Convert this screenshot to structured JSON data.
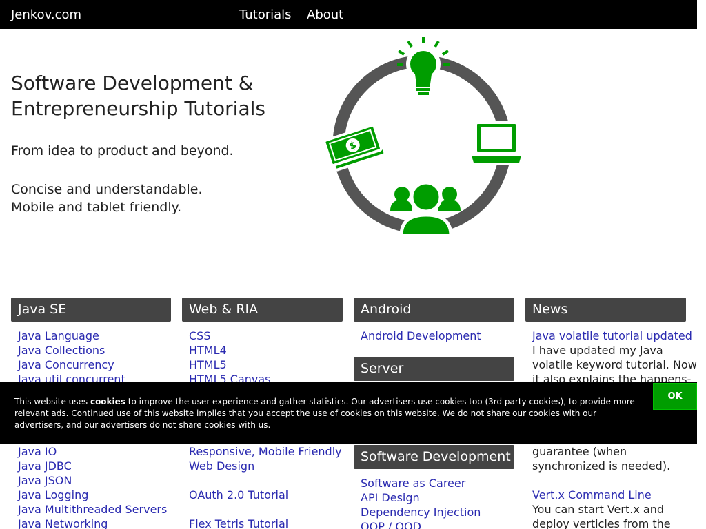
{
  "nav": {
    "brand": "Jenkov.com",
    "items": [
      {
        "label": "Tutorials"
      },
      {
        "label": "About"
      }
    ]
  },
  "hero": {
    "title_line1": "Software Development &",
    "title_line2": "Entrepreneurship Tutorials",
    "text1": "From idea to product and beyond.",
    "text2": "Concise and understandable.",
    "text3": "Mobile and tablet friendly.",
    "colors": {
      "ring": "#555555",
      "icon": "#009d00"
    }
  },
  "columns": {
    "java_se": {
      "title": "Java SE",
      "links": [
        "Java Language",
        "Java Collections",
        "Java Concurrency",
        "Java util.concurrent"
      ],
      "links_below": [
        "Java IO",
        "Java JDBC",
        "Java JSON",
        "Java Logging",
        "Java Multithreaded Servers",
        "Java Networking"
      ]
    },
    "web_ria": {
      "title": "Web & RIA",
      "links": [
        "CSS",
        "HTML4",
        "HTML5",
        "HTML5 Canvas"
      ],
      "responsive": [
        "Responsive, Mobile Friendly",
        "Web Design"
      ],
      "oauth": "OAuth 2.0 Tutorial",
      "flex": "Flex Tetris Tutorial"
    },
    "android": {
      "title": "Android",
      "links": [
        "Android Development"
      ]
    },
    "server": {
      "title": "Server"
    },
    "software_development": {
      "title": "Software Development",
      "links": [
        "Software as Career",
        "API Design",
        "Dependency Injection",
        "OOP / OOD"
      ]
    },
    "news": {
      "title": "News",
      "item1": {
        "title": "Java volatile tutorial updated",
        "lines_top": [
          "I have updated my Java",
          "volatile keyword tutorial. Now",
          "it also explains the happens-"
        ],
        "lines_bottom": [
          "guarantee (when",
          "synchronized is needed)."
        ]
      },
      "item2": {
        "title": "Vert.x Command Line",
        "lines": [
          "You can start Vert.x and",
          "deploy verticles from the"
        ]
      }
    }
  },
  "cookie": {
    "text_pre": "This website uses ",
    "text_bold": "cookies",
    "text_post": " to improve the user experience and gather statistics. Our advertisers use cookies too (3rd party cookies), to provide more relevant ads. Continued use of this website implies that you accept the use of cookies on this website. We do not share our cookies with our advertisers, and our advertisers do not share cookies with us.",
    "ok_label": "OK"
  }
}
